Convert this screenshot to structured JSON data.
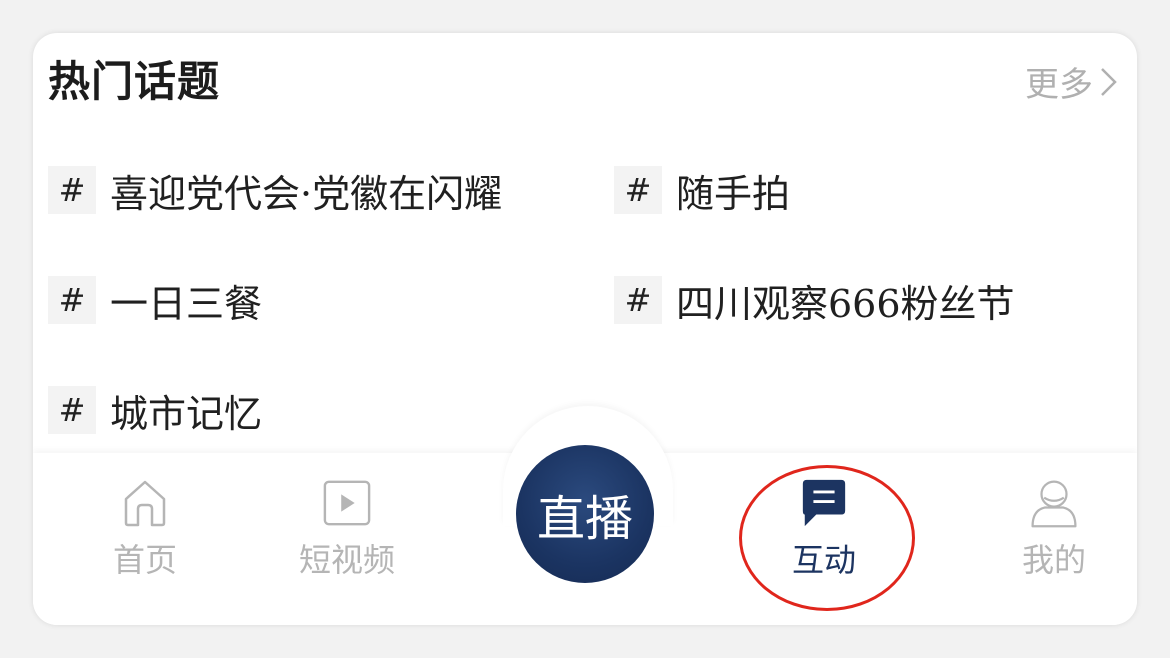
{
  "section": {
    "title": "热门话题",
    "more_label": "更多"
  },
  "topics": [
    {
      "label": "喜迎党代会·党徽在闪耀"
    },
    {
      "label": "随手拍"
    },
    {
      "label": "一日三餐"
    },
    {
      "label": "四川观察666粉丝节"
    },
    {
      "label": "城市记忆"
    }
  ],
  "hash_symbol": "#",
  "tabs": {
    "home": "首页",
    "short_video": "短视频",
    "live": "直播",
    "interact": "互动",
    "mine": "我的"
  },
  "colors": {
    "accent": "#1c3461",
    "inactive": "#b5b5b5",
    "annotation": "#e0261c"
  }
}
